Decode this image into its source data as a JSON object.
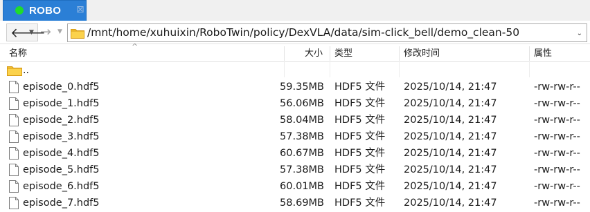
{
  "tab": {
    "title": "ROBO",
    "close": "⊠"
  },
  "nav": {
    "back": "🡐",
    "forward": "→",
    "caret": "▼"
  },
  "address": {
    "path": "/mnt/home/xuhuixin/RoboTwin/policy/DexVLA/data/sim-click_bell/demo_clean-50",
    "caret": "⌄"
  },
  "columns": {
    "name": "名称",
    "size": "大小",
    "type": "类型",
    "modified": "修改时间",
    "attributes": "属性"
  },
  "parent": {
    "name": ".."
  },
  "files": [
    {
      "name": "episode_0.hdf5",
      "size": "59.35MB",
      "type": "HDF5 文件",
      "modified": "2025/10/14, 21:47",
      "attributes": "-rw-rw-r--"
    },
    {
      "name": "episode_1.hdf5",
      "size": "56.06MB",
      "type": "HDF5 文件",
      "modified": "2025/10/14, 21:47",
      "attributes": "-rw-rw-r--"
    },
    {
      "name": "episode_2.hdf5",
      "size": "58.04MB",
      "type": "HDF5 文件",
      "modified": "2025/10/14, 21:47",
      "attributes": "-rw-rw-r--"
    },
    {
      "name": "episode_3.hdf5",
      "size": "57.38MB",
      "type": "HDF5 文件",
      "modified": "2025/10/14, 21:47",
      "attributes": "-rw-rw-r--"
    },
    {
      "name": "episode_4.hdf5",
      "size": "60.67MB",
      "type": "HDF5 文件",
      "modified": "2025/10/14, 21:47",
      "attributes": "-rw-rw-r--"
    },
    {
      "name": "episode_5.hdf5",
      "size": "57.38MB",
      "type": "HDF5 文件",
      "modified": "2025/10/14, 21:47",
      "attributes": "-rw-rw-r--"
    },
    {
      "name": "episode_6.hdf5",
      "size": "60.01MB",
      "type": "HDF5 文件",
      "modified": "2025/10/14, 21:47",
      "attributes": "-rw-rw-r--"
    },
    {
      "name": "episode_7.hdf5",
      "size": "58.69MB",
      "type": "HDF5 文件",
      "modified": "2025/10/14, 21:47",
      "attributes": "-rw-rw-r--"
    }
  ],
  "icons": {
    "status_dot": "status-dot-icon",
    "folder": "folder-icon",
    "file": "file-icon",
    "sort": "sort-ascending-icon"
  },
  "colors": {
    "tab_active": "#2b7fd6",
    "status_dot": "#1fdc2c",
    "folder": "#f4c431"
  }
}
